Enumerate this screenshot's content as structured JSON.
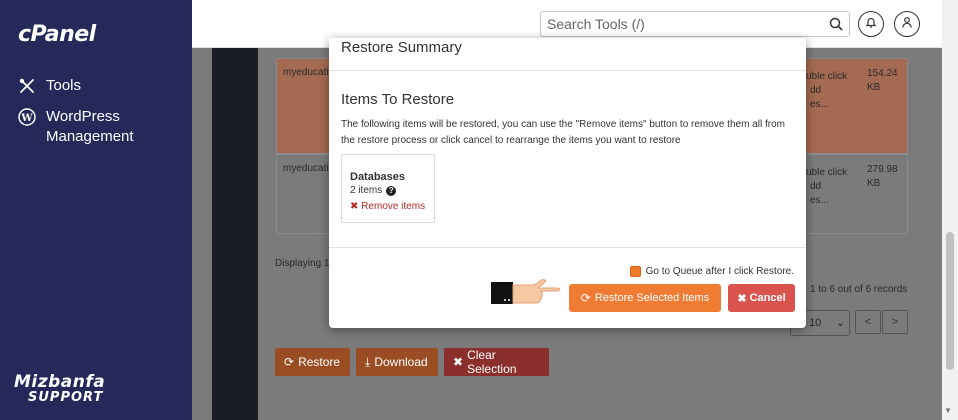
{
  "sidebar": {
    "logo": "cPanel",
    "items": [
      {
        "label": "Tools",
        "icon": "tools-icon"
      },
      {
        "label": "WordPress Management",
        "icon": "wordpress-icon"
      }
    ],
    "brand_line1": "Mizbanfa",
    "brand_line2": "SUPPORT"
  },
  "topbar": {
    "search_placeholder": "Search Tools (/)"
  },
  "background": {
    "row1_name": "myeducati",
    "row1_hint_1": "uble click",
    "row1_hint_2": "dd",
    "row1_hint_3": "es...",
    "row1_size_1": "154.24",
    "row1_size_2": "KB",
    "row2_name": "myeducati",
    "row2_hint_1": "uble click",
    "row2_hint_2": "dd",
    "row2_hint_3": "es...",
    "row2_size_1": "279.98",
    "row2_size_2": "KB",
    "displaying": "Displaying 1",
    "records": "1 to 6 out of 6 records",
    "per_page": "10",
    "prev": "<",
    "next": ">",
    "restore_btn": "Restore",
    "download_btn": "Download",
    "clear_btn": "Clear Selection"
  },
  "modal": {
    "title": "Restore Summary",
    "section_title": "Items To Restore",
    "description": "The following items will be restored, you can use the \"Remove items\" button to remove them all from the restore process or click cancel to rearrange the items you want to restore",
    "card": {
      "name": "Databases",
      "count": "2 items",
      "remove": "Remove items"
    },
    "queue_label": "Go to Queue after I click Restore.",
    "queue_checked": true,
    "restore_label": "Restore Selected Items",
    "cancel_label": "Cancel"
  },
  "colors": {
    "sidebar": "#24295a",
    "accent_orange": "#f07c34",
    "danger": "#d9534f"
  }
}
